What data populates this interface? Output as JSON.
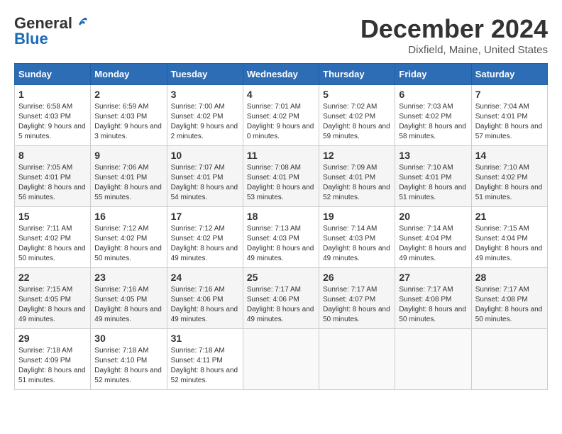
{
  "header": {
    "logo_line1": "General",
    "logo_line2": "Blue",
    "month": "December 2024",
    "location": "Dixfield, Maine, United States"
  },
  "weekdays": [
    "Sunday",
    "Monday",
    "Tuesday",
    "Wednesday",
    "Thursday",
    "Friday",
    "Saturday"
  ],
  "weeks": [
    [
      {
        "day": "1",
        "rise": "6:58 AM",
        "set": "4:03 PM",
        "daylight": "9 hours and 5 minutes"
      },
      {
        "day": "2",
        "rise": "6:59 AM",
        "set": "4:03 PM",
        "daylight": "9 hours and 3 minutes"
      },
      {
        "day": "3",
        "rise": "7:00 AM",
        "set": "4:02 PM",
        "daylight": "9 hours and 2 minutes"
      },
      {
        "day": "4",
        "rise": "7:01 AM",
        "set": "4:02 PM",
        "daylight": "9 hours and 0 minutes"
      },
      {
        "day": "5",
        "rise": "7:02 AM",
        "set": "4:02 PM",
        "daylight": "8 hours and 59 minutes"
      },
      {
        "day": "6",
        "rise": "7:03 AM",
        "set": "4:02 PM",
        "daylight": "8 hours and 58 minutes"
      },
      {
        "day": "7",
        "rise": "7:04 AM",
        "set": "4:01 PM",
        "daylight": "8 hours and 57 minutes"
      }
    ],
    [
      {
        "day": "8",
        "rise": "7:05 AM",
        "set": "4:01 PM",
        "daylight": "8 hours and 56 minutes"
      },
      {
        "day": "9",
        "rise": "7:06 AM",
        "set": "4:01 PM",
        "daylight": "8 hours and 55 minutes"
      },
      {
        "day": "10",
        "rise": "7:07 AM",
        "set": "4:01 PM",
        "daylight": "8 hours and 54 minutes"
      },
      {
        "day": "11",
        "rise": "7:08 AM",
        "set": "4:01 PM",
        "daylight": "8 hours and 53 minutes"
      },
      {
        "day": "12",
        "rise": "7:09 AM",
        "set": "4:01 PM",
        "daylight": "8 hours and 52 minutes"
      },
      {
        "day": "13",
        "rise": "7:10 AM",
        "set": "4:01 PM",
        "daylight": "8 hours and 51 minutes"
      },
      {
        "day": "14",
        "rise": "7:10 AM",
        "set": "4:02 PM",
        "daylight": "8 hours and 51 minutes"
      }
    ],
    [
      {
        "day": "15",
        "rise": "7:11 AM",
        "set": "4:02 PM",
        "daylight": "8 hours and 50 minutes"
      },
      {
        "day": "16",
        "rise": "7:12 AM",
        "set": "4:02 PM",
        "daylight": "8 hours and 50 minutes"
      },
      {
        "day": "17",
        "rise": "7:12 AM",
        "set": "4:02 PM",
        "daylight": "8 hours and 49 minutes"
      },
      {
        "day": "18",
        "rise": "7:13 AM",
        "set": "4:03 PM",
        "daylight": "8 hours and 49 minutes"
      },
      {
        "day": "19",
        "rise": "7:14 AM",
        "set": "4:03 PM",
        "daylight": "8 hours and 49 minutes"
      },
      {
        "day": "20",
        "rise": "7:14 AM",
        "set": "4:04 PM",
        "daylight": "8 hours and 49 minutes"
      },
      {
        "day": "21",
        "rise": "7:15 AM",
        "set": "4:04 PM",
        "daylight": "8 hours and 49 minutes"
      }
    ],
    [
      {
        "day": "22",
        "rise": "7:15 AM",
        "set": "4:05 PM",
        "daylight": "8 hours and 49 minutes"
      },
      {
        "day": "23",
        "rise": "7:16 AM",
        "set": "4:05 PM",
        "daylight": "8 hours and 49 minutes"
      },
      {
        "day": "24",
        "rise": "7:16 AM",
        "set": "4:06 PM",
        "daylight": "8 hours and 49 minutes"
      },
      {
        "day": "25",
        "rise": "7:17 AM",
        "set": "4:06 PM",
        "daylight": "8 hours and 49 minutes"
      },
      {
        "day": "26",
        "rise": "7:17 AM",
        "set": "4:07 PM",
        "daylight": "8 hours and 50 minutes"
      },
      {
        "day": "27",
        "rise": "7:17 AM",
        "set": "4:08 PM",
        "daylight": "8 hours and 50 minutes"
      },
      {
        "day": "28",
        "rise": "7:17 AM",
        "set": "4:08 PM",
        "daylight": "8 hours and 50 minutes"
      }
    ],
    [
      {
        "day": "29",
        "rise": "7:18 AM",
        "set": "4:09 PM",
        "daylight": "8 hours and 51 minutes"
      },
      {
        "day": "30",
        "rise": "7:18 AM",
        "set": "4:10 PM",
        "daylight": "8 hours and 52 minutes"
      },
      {
        "day": "31",
        "rise": "7:18 AM",
        "set": "4:11 PM",
        "daylight": "8 hours and 52 minutes"
      },
      null,
      null,
      null,
      null
    ]
  ]
}
